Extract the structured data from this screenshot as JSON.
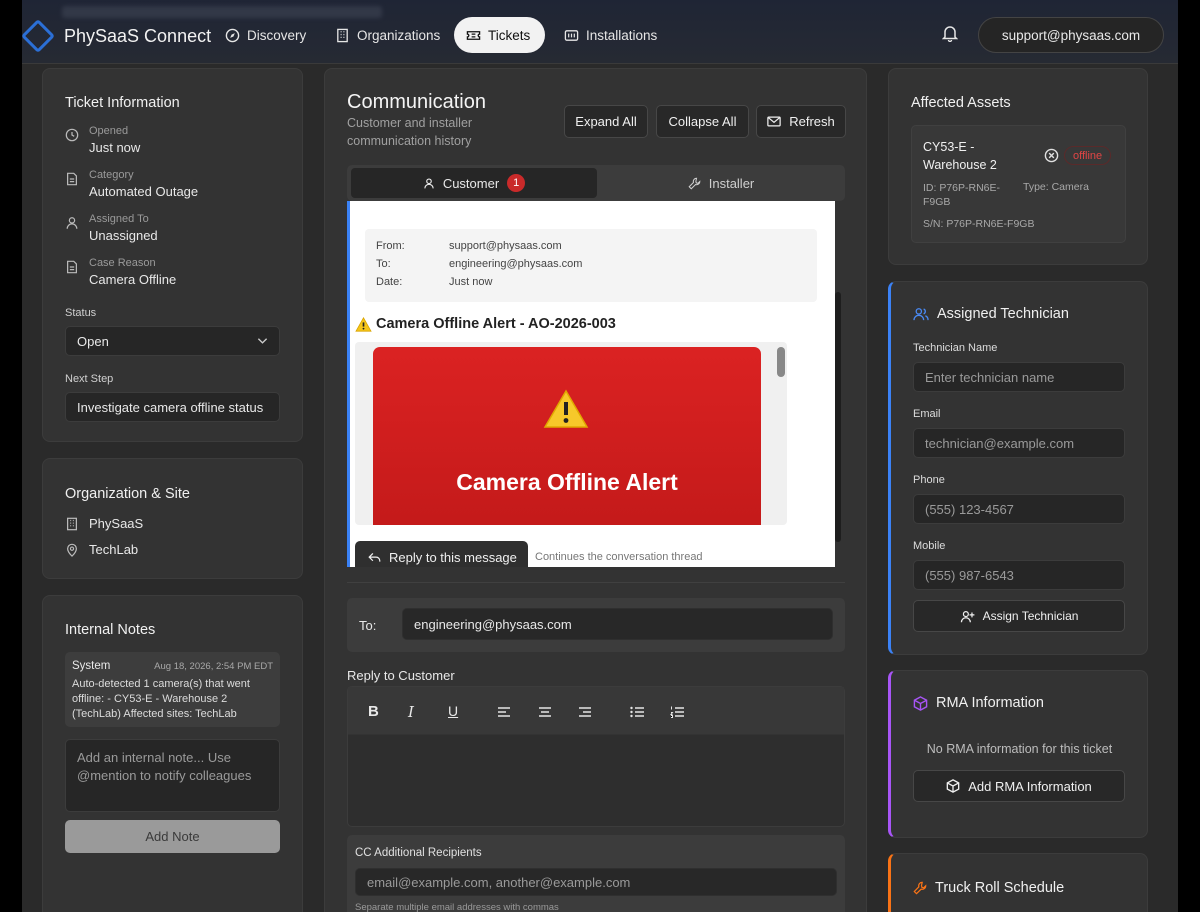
{
  "app": {
    "brand": "PhySaaS Connect",
    "account": "support@physaas.com"
  },
  "nav": [
    {
      "label": "Discovery",
      "icon": "compass-icon"
    },
    {
      "label": "Organizations",
      "icon": "building-icon"
    },
    {
      "label": "Tickets",
      "icon": "ticket-icon",
      "active": true
    },
    {
      "label": "Installations",
      "icon": "installations-icon"
    }
  ],
  "ticket_info": {
    "title": "Ticket Information",
    "opened_label": "Opened",
    "opened_value": "Just now",
    "category_label": "Category",
    "category_value": "Automated Outage",
    "assigned_label": "Assigned To",
    "assigned_value": "Unassigned",
    "reason_label": "Case Reason",
    "reason_value": "Camera Offline",
    "status_label": "Status",
    "status_value": "Open",
    "next_step_label": "Next Step",
    "next_step_value": "Investigate camera offline status"
  },
  "org_site": {
    "title": "Organization & Site",
    "organization": "PhySaaS",
    "site": "TechLab"
  },
  "internal_notes": {
    "title": "Internal Notes",
    "note_author": "System",
    "note_time": "Aug 18, 2026, 2:54 PM EDT",
    "note_body": "Auto-detected 1 camera(s) that went offline: - CY53-E - Warehouse 2 (TechLab) Affected sites: TechLab",
    "input_placeholder": "Add an internal note... Use @mention to notify colleagues",
    "add_button": "Add Note"
  },
  "communication": {
    "title": "Communication",
    "subtitle": "Customer and installer communication history",
    "expand_all": "Expand All",
    "collapse_all": "Collapse All",
    "refresh": "Refresh",
    "tabs": [
      {
        "label": "Customer",
        "badge": "1",
        "active": true
      },
      {
        "label": "Installer"
      }
    ],
    "email": {
      "from_label": "From:",
      "from": "support@physaas.com",
      "to_label": "To:",
      "to": "engineering@physaas.com",
      "date_label": "Date:",
      "date": "Just now",
      "subject": "Camera Offline Alert - AO-2026-003",
      "banner_title": "Camera Offline Alert",
      "reply_button": "Reply to this message",
      "reply_hint": "Continues the conversation thread"
    },
    "compose": {
      "to_label": "To:",
      "to_value": "engineering@physaas.com",
      "reply_label": "Reply to Customer",
      "cc_label": "CC Additional Recipients",
      "cc_placeholder": "email@example.com, another@example.com",
      "cc_hint": "Separate multiple email addresses with commas"
    }
  },
  "affected_assets": {
    "title": "Affected Assets",
    "asset_name": "CY53-E - Warehouse 2",
    "status": "offline",
    "id_text": "ID: P76P-RN6E-F9GB",
    "type_text": "Type: Camera",
    "sn_text": "S/N: P76P-RN6E-F9GB"
  },
  "technician": {
    "title": "Assigned Technician",
    "name_label": "Technician Name",
    "name_placeholder": "Enter technician name",
    "email_label": "Email",
    "email_placeholder": "technician@example.com",
    "phone_label": "Phone",
    "phone_placeholder": "(555) 123-4567",
    "mobile_label": "Mobile",
    "mobile_placeholder": "(555) 987-6543",
    "assign_button": "Assign Technician"
  },
  "rma": {
    "title": "RMA Information",
    "empty_text": "No RMA information for this ticket",
    "add_button": "Add RMA Information"
  },
  "truck_roll": {
    "title": "Truck Roll Schedule"
  },
  "colors": {
    "accent_blue": "#3b82f6",
    "accent_purple": "#a855f7",
    "accent_orange": "#f97316",
    "alert_red": "#d42020",
    "offline_red": "#e04545"
  }
}
